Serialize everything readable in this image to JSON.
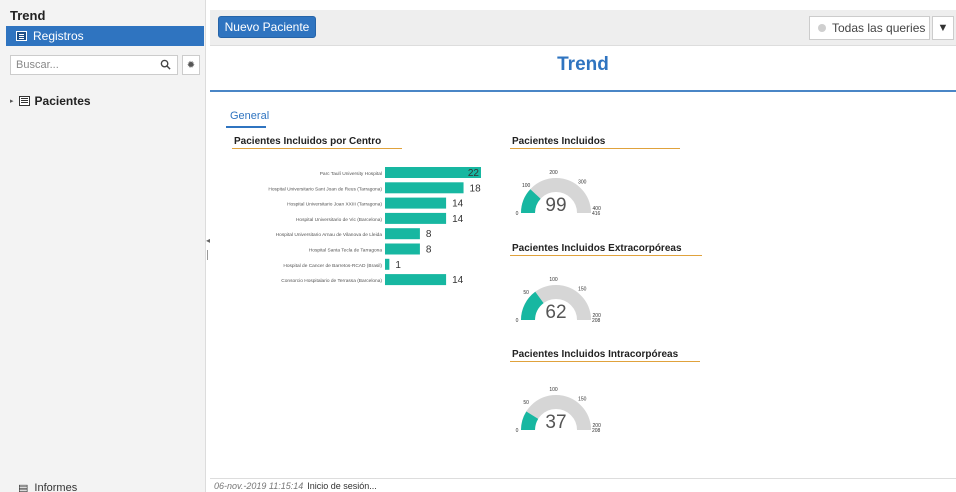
{
  "sidebar": {
    "title": "Trend",
    "active_item": "Registros",
    "search_placeholder": "Buscar...",
    "tree": [
      {
        "label": "Pacientes"
      }
    ],
    "bottom_item": "Informes"
  },
  "toolbar": {
    "new_button": "Nuevo Paciente",
    "queries_button": "Todas las queries"
  },
  "page": {
    "title": "Trend",
    "tabs": [
      {
        "label": "General"
      }
    ]
  },
  "status": {
    "timestamp": "06-nov.-2019 11:15:14",
    "message": "Inicio de sesión..."
  },
  "colors": {
    "accent": "#2f74c0",
    "bar": "#17b7a1",
    "gauge_bg": "#d6d6d6",
    "rule": "#e0a23c"
  },
  "chart_data": [
    {
      "type": "bar",
      "title": "Pacientes Incluidos por Centro",
      "categories": [
        "Parc Taulí University Hospital",
        "Hospital Universitario Sant Joan de Reus (Tarragona)",
        "Hospital Universitario Joan XXIII (Tarragona)",
        "Hospital Universitario de Vic (Barcelona)",
        "Hospital Universitario Arnau de Vilanova de Lleida",
        "Hospital Santa Tecla de Tarragona",
        "Hospital de Cancer de Barretos-RCAD (Brasil)",
        "Consorcio Hospitalario de Terrassa (Barcelona)"
      ],
      "values": [
        22,
        18,
        14,
        14,
        8,
        8,
        1,
        14
      ],
      "xlim": [
        0,
        22
      ]
    },
    {
      "type": "gauge",
      "title": "Pacientes Incluidos",
      "value": 99,
      "min": 0,
      "max": 416,
      "ticks": [
        "100",
        "200",
        "300",
        "400"
      ],
      "min_label": "0",
      "max_label": "416"
    },
    {
      "type": "gauge",
      "title": "Pacientes Incluidos Extracorpóreas",
      "value": 62,
      "min": 0,
      "max": 208,
      "ticks": [
        "50",
        "100",
        "150",
        "200"
      ],
      "min_label": "0",
      "max_label": "208"
    },
    {
      "type": "gauge",
      "title": "Pacientes Incluidos Intracorpóreas",
      "value": 37,
      "min": 0,
      "max": 208,
      "ticks": [
        "50",
        "100",
        "150",
        "200"
      ],
      "min_label": "0",
      "max_label": "208"
    }
  ]
}
